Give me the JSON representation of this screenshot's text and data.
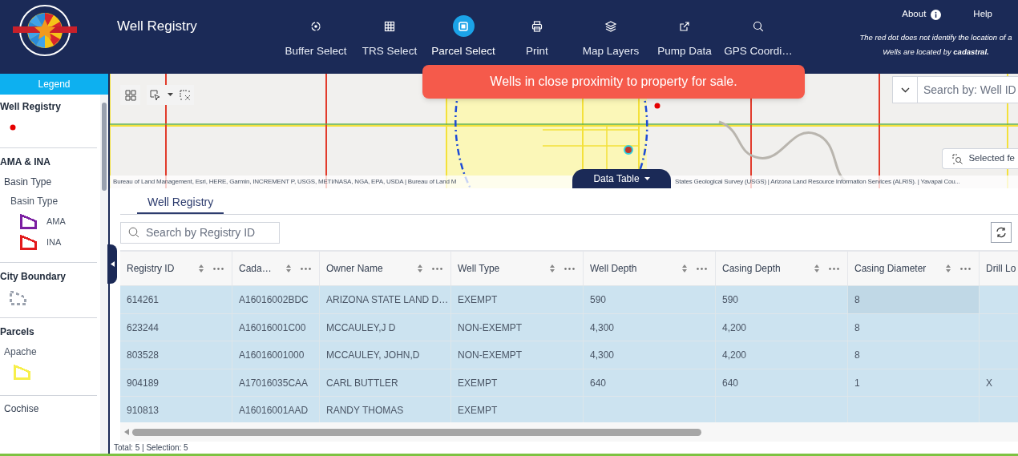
{
  "header": {
    "title": "Well Registry",
    "nav": [
      {
        "label": "Buffer Select",
        "selected": false
      },
      {
        "label": "TRS Select",
        "selected": false
      },
      {
        "label": "Parcel Select",
        "selected": true
      },
      {
        "label": "Print",
        "selected": false
      },
      {
        "label": "Map Layers",
        "selected": false
      },
      {
        "label": "Pump Data",
        "selected": false
      },
      {
        "label": "GPS Coordi…",
        "selected": false
      }
    ],
    "links": [
      "About",
      "Help"
    ],
    "note": [
      "The red dot does not identify the location of a",
      "Wells are located by **cadastral.**"
    ]
  },
  "legend": {
    "title": "Legend",
    "sections": [
      {
        "label": "Well Registry",
        "symbols": [
          {
            "kind": "dot",
            "color": "#e60000"
          }
        ]
      },
      {
        "label": "AMA & INA",
        "children": [
          {
            "label": "Basin Type",
            "children": [
              {
                "label": "Basin Type",
                "symbols": [
                  {
                    "kind": "polygon",
                    "label": "AMA",
                    "color": "#7b1fa2"
                  },
                  {
                    "kind": "polygon",
                    "label": "INA",
                    "color": "#e31a1c"
                  }
                ]
              }
            ]
          }
        ]
      },
      {
        "label": "City Boundary",
        "symbols": [
          {
            "kind": "dashed",
            "color": "#9ca3af"
          }
        ]
      },
      {
        "label": "Parcels",
        "children": [
          {
            "label": "Apache",
            "symbols": [
              {
                "kind": "polygon",
                "color": "#f7ef4a"
              }
            ]
          },
          {
            "label": "Cochise"
          }
        ]
      }
    ]
  },
  "map": {
    "toast": "Wells in close proximity to property for sale.",
    "search": {
      "placeholder": "Search by: Well ID"
    },
    "selected_button": "Selected fe",
    "data_table_tab": "Data Table",
    "attribution": [
      "Bureau of Land Management, Esri, HERE, Garmin, INCREMENT P, USGS, METI/NASA, NGA, EPA, USDA | Bureau of Land M",
      "States Geological Survey (USGS) | Arizona Land Resource Information Services (ALRIS). | Yavapai Cou..."
    ]
  },
  "table": {
    "tabs": [
      {
        "label": "Well Registry",
        "selected": true
      }
    ],
    "search": {
      "placeholder": "Search by Registry ID"
    },
    "columns": [
      "Registry ID",
      "Cada…",
      "Owner Name",
      "Well Type",
      "Well Depth",
      "Casing Depth",
      "Casing Diameter",
      "Drill Lo"
    ],
    "rows": [
      {
        "selected": true,
        "cells": [
          {
            "text": "614261",
            "focused": false
          },
          {
            "text": "A16016002BDC",
            "focused": false
          },
          {
            "text": "ARIZONA STATE LAND D…",
            "focused": false
          },
          {
            "text": "EXEMPT",
            "focused": false
          },
          {
            "text": "590",
            "focused": false
          },
          {
            "text": "590",
            "focused": false
          },
          {
            "text": "8",
            "focused": true
          },
          {
            "focused": false
          }
        ]
      },
      {
        "selected": true,
        "cells": [
          {
            "text": "623244",
            "focused": false
          },
          {
            "text": "A16016001C00",
            "focused": false
          },
          {
            "text": "MCCAULEY,J D",
            "focused": false
          },
          {
            "text": "NON-EXEMPT",
            "focused": false
          },
          {
            "text": "4,300",
            "focused": false
          },
          {
            "text": "4,200",
            "focused": false
          },
          {
            "text": "8",
            "focused": false
          },
          {
            "focused": false
          }
        ]
      },
      {
        "selected": true,
        "cells": [
          {
            "text": "803528",
            "focused": false
          },
          {
            "text": "A16016001000",
            "focused": false
          },
          {
            "text": "MCCAULEY, JOHN,D",
            "focused": false
          },
          {
            "text": "NON-EXEMPT",
            "focused": false
          },
          {
            "text": "4,300",
            "focused": false
          },
          {
            "text": "4,200",
            "focused": false
          },
          {
            "text": "8",
            "focused": false
          },
          {
            "focused": false
          }
        ]
      },
      {
        "selected": true,
        "cells": [
          {
            "text": "904189",
            "focused": false
          },
          {
            "text": "A17016035CAA",
            "focused": false
          },
          {
            "text": "CARL BUTTLER",
            "focused": false
          },
          {
            "text": "EXEMPT",
            "focused": false
          },
          {
            "text": "640",
            "focused": false
          },
          {
            "text": "640",
            "focused": false
          },
          {
            "text": "1",
            "focused": false
          },
          {
            "text": "X",
            "focused": false
          }
        ]
      },
      {
        "selected": true,
        "cells": [
          {
            "text": "910813",
            "focused": false
          },
          {
            "text": "A16016001AAD",
            "focused": false
          },
          {
            "text": "RANDY THOMAS",
            "focused": false
          },
          {
            "text": "EXEMPT",
            "focused": false
          },
          {
            "focused": false
          },
          {
            "focused": false
          },
          {
            "focused": false
          },
          {
            "focused": false
          }
        ]
      }
    ],
    "status": "Total: 5 | Selection: 5"
  }
}
